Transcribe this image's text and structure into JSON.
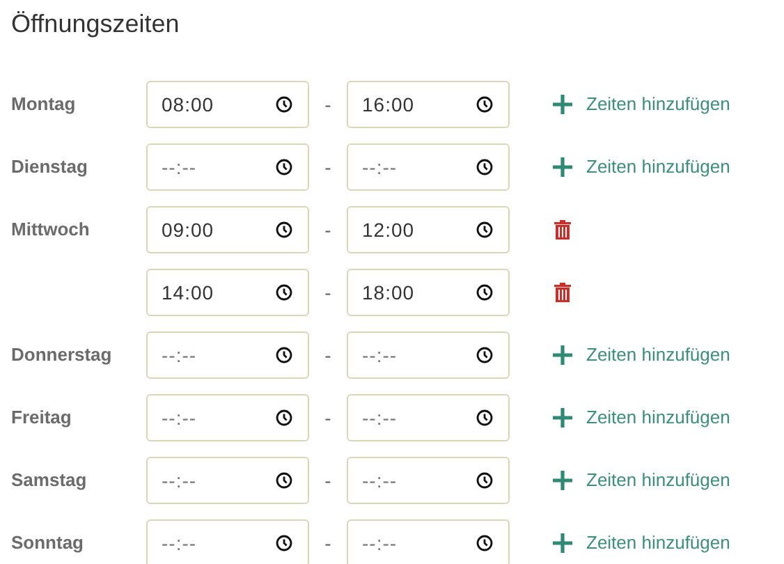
{
  "title": "Öffnungszeiten",
  "days": [
    {
      "label": "Montag",
      "slots": [
        {
          "from": {
            "value": "08:00"
          },
          "separator": "-",
          "to": {
            "value": "16:00"
          },
          "action": {
            "kind": "add",
            "label": "Zeiten hinzufügen"
          }
        }
      ]
    },
    {
      "label": "Dienstag",
      "slots": [
        {
          "from": {
            "placeholder": "--:--"
          },
          "separator": "-",
          "to": {
            "placeholder": "--:--"
          },
          "action": {
            "kind": "add",
            "label": "Zeiten hinzufügen"
          }
        }
      ]
    },
    {
      "label": "Mittwoch",
      "slots": [
        {
          "from": {
            "value": "09:00"
          },
          "separator": "-",
          "to": {
            "value": "12:00"
          },
          "action": {
            "kind": "delete"
          }
        },
        {
          "from": {
            "value": "14:00"
          },
          "separator": "-",
          "to": {
            "value": "18:00"
          },
          "action": {
            "kind": "delete"
          }
        }
      ]
    },
    {
      "label": "Donnerstag",
      "slots": [
        {
          "from": {
            "placeholder": "--:--"
          },
          "separator": "-",
          "to": {
            "placeholder": "--:--"
          },
          "action": {
            "kind": "add",
            "label": "Zeiten hinzufügen"
          }
        }
      ]
    },
    {
      "label": "Freitag",
      "slots": [
        {
          "from": {
            "placeholder": "--:--"
          },
          "separator": "-",
          "to": {
            "placeholder": "--:--"
          },
          "action": {
            "kind": "add",
            "label": "Zeiten hinzufügen"
          }
        }
      ]
    },
    {
      "label": "Samstag",
      "slots": [
        {
          "from": {
            "placeholder": "--:--"
          },
          "separator": "-",
          "to": {
            "placeholder": "--:--"
          },
          "action": {
            "kind": "add",
            "label": "Zeiten hinzufügen"
          }
        }
      ]
    },
    {
      "label": "Sonntag",
      "slots": [
        {
          "from": {
            "placeholder": "--:--"
          },
          "separator": "-",
          "to": {
            "placeholder": "--:--"
          },
          "action": {
            "kind": "add",
            "label": "Zeiten hinzufügen"
          }
        }
      ]
    }
  ]
}
